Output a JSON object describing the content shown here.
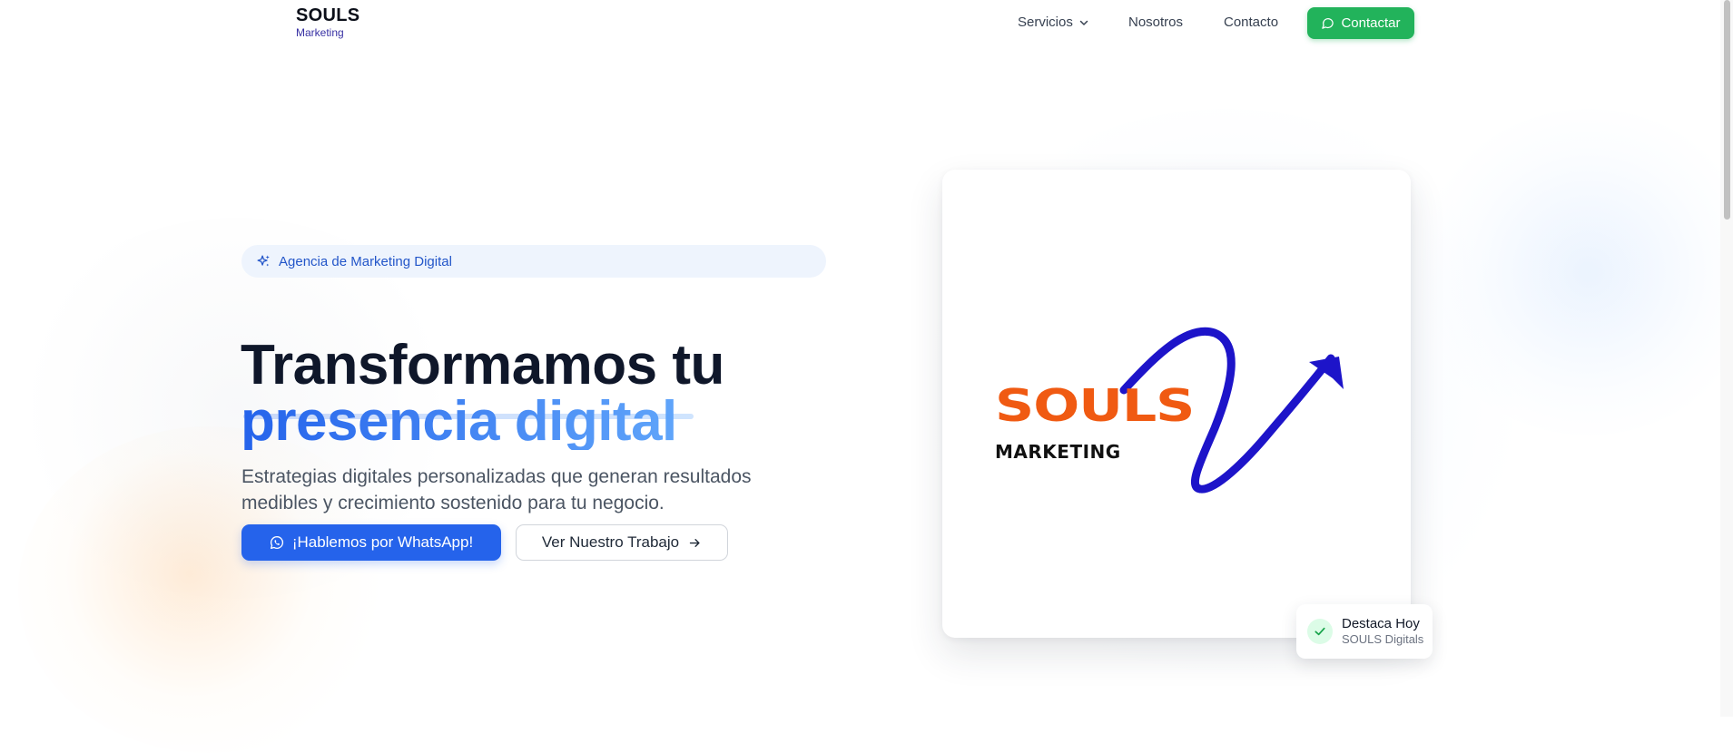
{
  "brand": {
    "name": "SOULS",
    "tagline": "Marketing"
  },
  "nav": {
    "items": [
      {
        "label": "Servicios",
        "icon": "chevron-down-icon"
      },
      {
        "label": "Nosotros"
      },
      {
        "label": "Contacto"
      }
    ],
    "cta": {
      "label": "Contactar",
      "icon": "message-circle-icon"
    }
  },
  "hero": {
    "pill": {
      "label": "Agencia de Marketing Digital",
      "icon": "sparkles-icon"
    },
    "title_line1": "Transformamos tu",
    "title_line2": "presencia digital",
    "lead": "Estrategias digitales personalizadas que generan resultados medibles y crecimiento sostenido para tu negocio.",
    "primary_button": {
      "label": "¡Hablemos por WhatsApp!",
      "icon": "whatsapp-icon"
    },
    "secondary_button": {
      "label": "Ver Nuestro Trabajo",
      "icon": "arrow-right-icon"
    }
  },
  "logo_card": {
    "word": "SOULS",
    "sub": "MARKETING"
  },
  "badge": {
    "title": "Destaca Hoy",
    "subtitle": "SOULS Digitals",
    "icon": "check-icon"
  },
  "colors": {
    "accent_blue": "#2563eb",
    "cta_green": "#22b35b",
    "logo_orange": "#f05a12",
    "logo_swoosh": "#1d14c9"
  }
}
